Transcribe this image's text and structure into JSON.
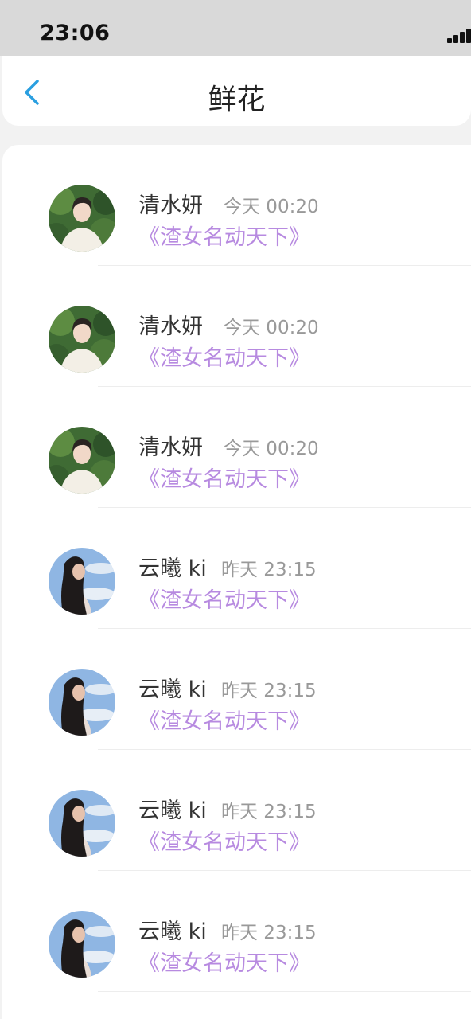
{
  "status_bar": {
    "time": "23:06"
  },
  "nav": {
    "title": "鲜花"
  },
  "items": [
    {
      "name": "清水妍",
      "time": "今天 00:20",
      "book": "《渣女名动天下》",
      "avatar": "young-man-avatar"
    },
    {
      "name": "清水妍",
      "time": "今天 00:20",
      "book": "《渣女名动天下》",
      "avatar": "young-man-avatar"
    },
    {
      "name": "清水妍",
      "time": "今天 00:20",
      "book": "《渣女名动天下》",
      "avatar": "young-man-avatar"
    },
    {
      "name": "云曦 ki",
      "time": "昨天 23:15",
      "book": "《渣女名动天下》",
      "avatar": "woman-sky-avatar"
    },
    {
      "name": "云曦 ki",
      "time": "昨天 23:15",
      "book": "《渣女名动天下》",
      "avatar": "woman-sky-avatar"
    },
    {
      "name": "云曦 ki",
      "time": "昨天 23:15",
      "book": "《渣女名动天下》",
      "avatar": "woman-sky-avatar"
    },
    {
      "name": "云曦 ki",
      "time": "昨天 23:15",
      "book": "《渣女名动天下》",
      "avatar": "woman-sky-avatar"
    }
  ],
  "colors": {
    "accent_back": "#2a9fe0",
    "book_title": "#b78ae0",
    "status_bar_bg": "#d9d9d9"
  },
  "icons": {
    "back": "chevron-left-icon",
    "signal": "signal-icon"
  }
}
